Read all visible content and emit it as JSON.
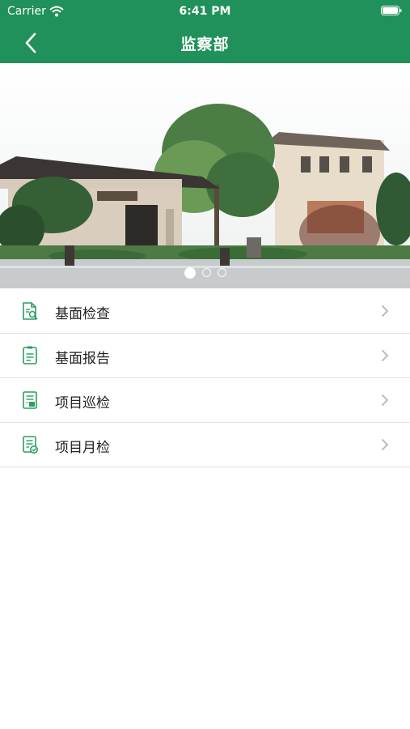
{
  "status_bar": {
    "carrier": "Carrier",
    "time": "6:41 PM"
  },
  "nav": {
    "title": "监察部"
  },
  "banner": {
    "pages": 3,
    "active_index": 0
  },
  "menu": [
    {
      "label": "基面检查",
      "icon": "inspection-search-icon"
    },
    {
      "label": "基面报告",
      "icon": "report-document-icon"
    },
    {
      "label": "项目巡检",
      "icon": "patrol-checklist-icon"
    },
    {
      "label": "项目月检",
      "icon": "monthly-check-icon"
    }
  ],
  "colors": {
    "primary": "#20915a",
    "icon_green": "#2a9d62",
    "divider": "#e3e3e3"
  }
}
